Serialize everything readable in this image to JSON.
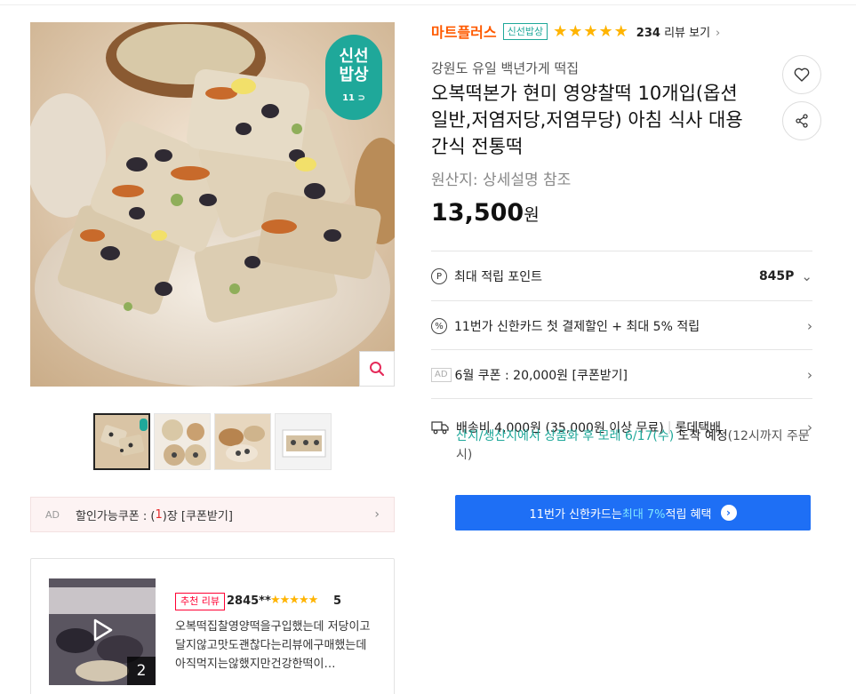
{
  "gallery": {
    "badge_line1": "신선",
    "badge_line2": "밥상",
    "badge_logo": "11",
    "zoom_icon": "search-icon",
    "thumb_count": 4
  },
  "coupon_bar": {
    "ad_label": "AD",
    "text_before": "할인가능쿠폰 : (",
    "count": "1",
    "text_after": ")장 [쿠폰받기]"
  },
  "review": {
    "media_count": "2",
    "badge": "추천 리뷰",
    "user": "2845**",
    "stars": "★★★★★",
    "score": "5",
    "text": "오복떡집찰영양떡을구입했는데 저당이고 달지않고맛도괜찮다는리뷰에구매했는데 아직먹지는않했지만건강한떡이…"
  },
  "store": {
    "name": "마트플러스",
    "tag": "신선밥상",
    "rating_stars": "★★★★★",
    "review_count": "234",
    "review_label": "리뷰 보기"
  },
  "product": {
    "seller_line": "강원도 유일 백년가게 떡집",
    "title": "오복떡본가 현미 영양찰떡 10개입(옵션 일반,저염저당,저염무당) 아침 식사 대용 간식 전통떡",
    "origin": "원산지: 상세설명 참조",
    "price": "13,500",
    "currency": "원"
  },
  "benefits": {
    "points_icon": "P",
    "points_label": "최대 적립 포인트",
    "points_value": "845P",
    "card_icon": "%",
    "card_label": "11번가 신한카드 첫 결제할인 + 최대 5% 적립",
    "coupon_ad": "AD",
    "coupon_label": "6월 쿠폰 : 20,000원 [쿠폰받기]",
    "shipping_label": "배송비 4,000원 (35,000원 이상 무료)",
    "carrier": "롯데택배",
    "delivery_teal": "산지/생산지에서 상품화 후 모레 6/17(수)",
    "delivery_dark": " 도착 예정",
    "delivery_note": "(12시까지 주문 시)"
  },
  "card_banner": {
    "text_before": "11번가 신한카드는 ",
    "highlight": "최대 7%",
    "text_after": " 적립 혜택"
  },
  "colors": {
    "store_orange": "#ff5a00",
    "teal": "#1fa89a",
    "banner_blue": "#1e6ff5",
    "star_yellow": "#ffb400",
    "coupon_red": "#e52b2b"
  }
}
